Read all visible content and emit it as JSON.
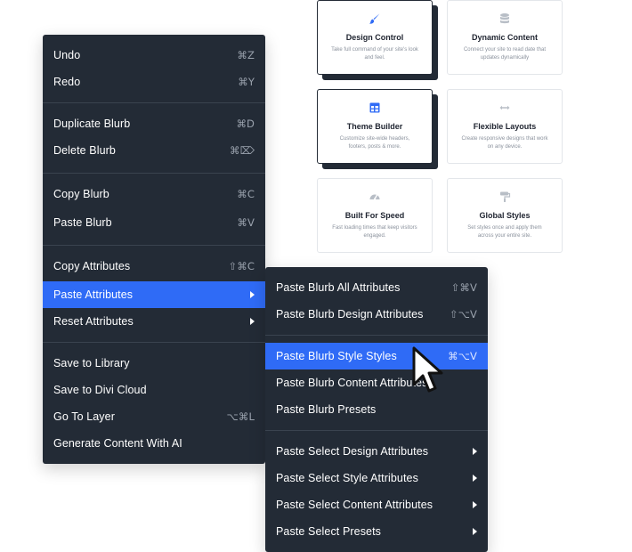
{
  "cards": [
    {
      "title": "Design Control",
      "desc": "Take full command of your site's look and feel.",
      "icon": "brush-icon"
    },
    {
      "title": "Dynamic Content",
      "desc": "Connect your site to read date that updates dynamically",
      "icon": "database-icon"
    },
    {
      "title": "Theme Builder",
      "desc": "Customize site-wide headers, footers, posts & more.",
      "icon": "layout-grid-icon"
    },
    {
      "title": "Flexible Layouts",
      "desc": "Create responsive designs that work on any device.",
      "icon": "resize-horizontal-icon"
    },
    {
      "title": "Built For Speed",
      "desc": "Fast loading times that keep visitors engaged.",
      "icon": "speedometer-icon"
    },
    {
      "title": "Global Styles",
      "desc": "Set styles once and apply them across your entire site.",
      "icon": "paint-roller-icon"
    }
  ],
  "main_menu": {
    "undo": {
      "label": "Undo",
      "shortcut": "⌘Z"
    },
    "redo": {
      "label": "Redo",
      "shortcut": "⌘Y"
    },
    "duplicate": {
      "label": "Duplicate Blurb",
      "shortcut": "⌘D"
    },
    "delete": {
      "label": "Delete Blurb",
      "shortcut": "⌘⌦"
    },
    "copy": {
      "label": "Copy Blurb",
      "shortcut": "⌘C"
    },
    "paste": {
      "label": "Paste Blurb",
      "shortcut": "⌘V"
    },
    "copy_attributes": {
      "label": "Copy Attributes",
      "shortcut": "⇧⌘C"
    },
    "paste_attributes": {
      "label": "Paste Attributes"
    },
    "reset_attributes": {
      "label": "Reset Attributes"
    },
    "save_library": {
      "label": "Save to Library"
    },
    "save_cloud": {
      "label": "Save to Divi Cloud"
    },
    "go_to_layer": {
      "label": "Go To Layer",
      "shortcut": "⌥⌘L"
    },
    "generate_ai": {
      "label": "Generate Content With AI"
    }
  },
  "sub_menu": {
    "all": {
      "label": "Paste Blurb All Attributes",
      "shortcut": "⇧⌘V"
    },
    "design": {
      "label": "Paste Blurb Design Attributes",
      "shortcut": "⇧⌥V"
    },
    "style": {
      "label": "Paste Blurb Style Styles",
      "shortcut": "⌘⌥V"
    },
    "content": {
      "label": "Paste Blurb Content Attributes"
    },
    "presets": {
      "label": "Paste Blurb Presets"
    },
    "sel_design": {
      "label": "Paste Select Design Attributes"
    },
    "sel_style": {
      "label": "Paste Select Style Attributes"
    },
    "sel_content": {
      "label": "Paste Select Content Attributes"
    },
    "sel_presets": {
      "label": "Paste Select Presets"
    }
  },
  "colors": {
    "menu_bg": "#232b36",
    "highlight": "#2f6bf6",
    "accent_icon": "#2f6bf6",
    "muted_icon": "#b8bec6"
  }
}
